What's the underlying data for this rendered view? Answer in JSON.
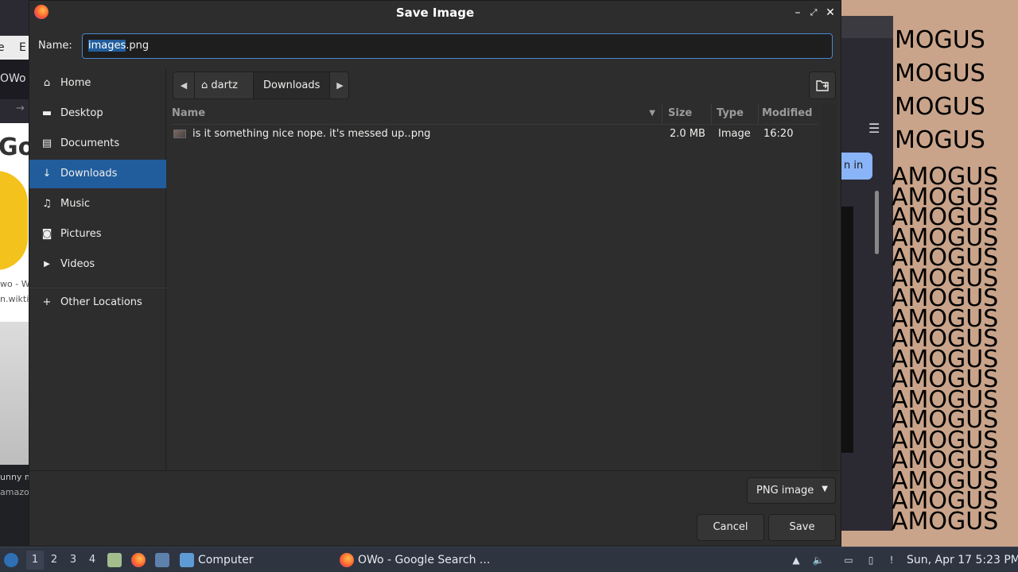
{
  "background": {
    "left_menu": [
      "e",
      "E"
    ],
    "left_tab": "OWo",
    "left_search_logo": "Go",
    "left_snippet_1": "wo - W",
    "left_snippet_2": "n.wikti",
    "left_snippet_3": "unny m",
    "left_snippet_4": "amazon.",
    "right_signin": "n in",
    "right_meme_text": "MOGUS",
    "right_meme_text_dense": "AMOGUS"
  },
  "dialog": {
    "title": "Save Image",
    "name_label": "Name:",
    "filename_selected": "images",
    "filename_rest": ".png",
    "sidebar": [
      {
        "label": "Home",
        "icon": "home-icon",
        "glyph": "⌂"
      },
      {
        "label": "Desktop",
        "icon": "folder-icon",
        "glyph": "▬"
      },
      {
        "label": "Documents",
        "icon": "document-icon",
        "glyph": "▤"
      },
      {
        "label": "Downloads",
        "icon": "download-icon",
        "glyph": "↓"
      },
      {
        "label": "Music",
        "icon": "music-icon",
        "glyph": "♫"
      },
      {
        "label": "Pictures",
        "icon": "camera-icon",
        "glyph": "◙"
      },
      {
        "label": "Videos",
        "icon": "video-icon",
        "glyph": "▶"
      },
      {
        "label": "Other Locations",
        "icon": "plus-icon",
        "glyph": "+"
      }
    ],
    "active_sidebar": "Downloads",
    "path": [
      "dartz",
      "Downloads"
    ],
    "columns": {
      "name": "Name",
      "size": "Size",
      "type": "Type",
      "modified": "Modified"
    },
    "files": [
      {
        "name": "is it something nice nope. it's messed up..png",
        "size": "2.0 MB",
        "type": "Image",
        "modified": "16:20"
      }
    ],
    "filter": "PNG image",
    "cancel": "Cancel",
    "save": "Save"
  },
  "taskbar": {
    "workspaces": [
      "1",
      "2",
      "3",
      "4"
    ],
    "active_workspace": "1",
    "files_window": "Computer",
    "browser_window": "OWo - Google Search ...",
    "clock": "Sun, Apr 17  5:23 PM"
  },
  "colors": {
    "dialog_bg": "#2d2d2d",
    "selection": "#215d9c",
    "focus_border": "#4a88d0",
    "taskbar_bg": "#2e3440"
  }
}
